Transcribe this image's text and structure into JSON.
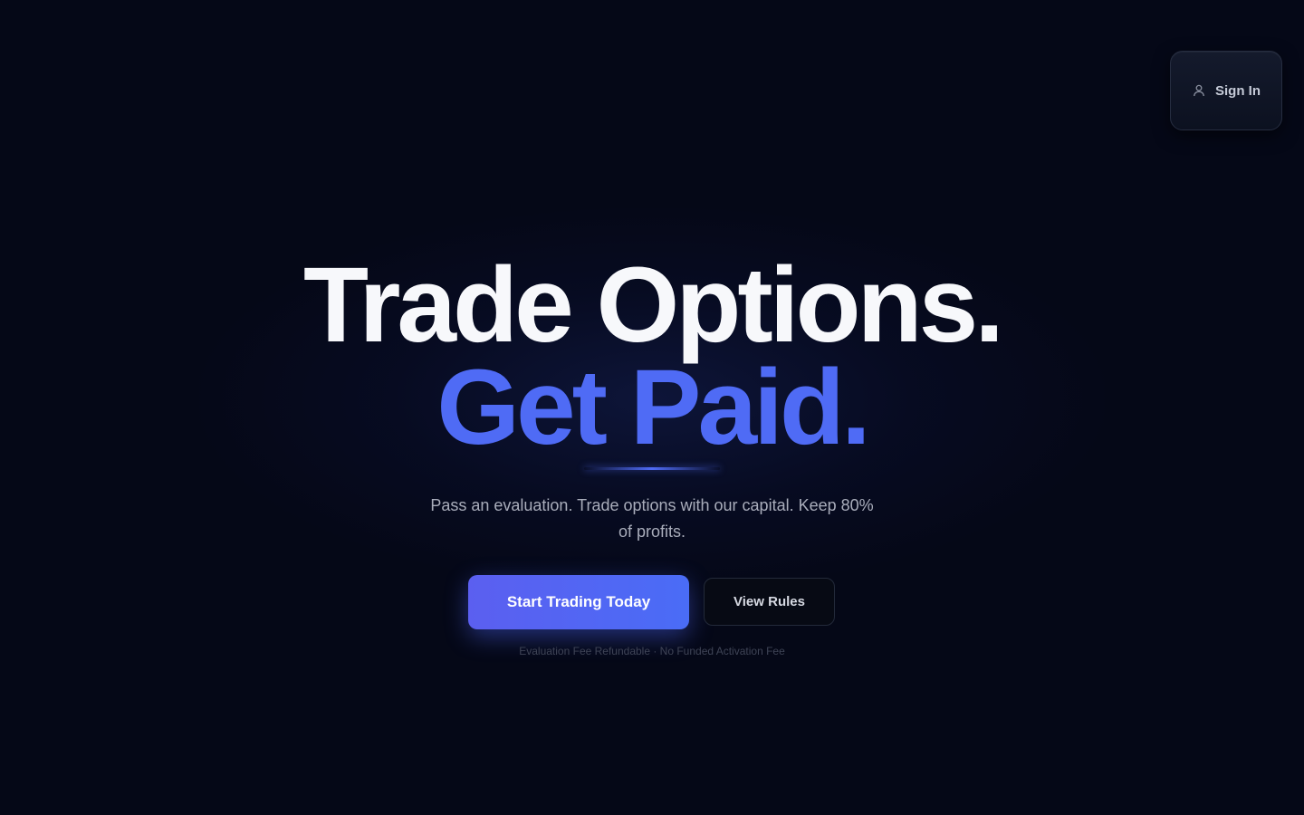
{
  "header": {
    "signin_label": "Sign In",
    "signin_icon": "user-icon"
  },
  "hero": {
    "headline_line1": "Trade Options.",
    "headline_line2": "Get Paid.",
    "subtitle": "Pass an evaluation. Trade options with our capital. Keep 80% of profits.",
    "primary_cta": "Start Trading Today",
    "secondary_cta": "View Rules",
    "fineprint": "Evaluation Fee Refundable · No Funded Activation Fee"
  },
  "colors": {
    "background": "#050817",
    "accent": "#4f6bf5",
    "headline": "#f7f8fb",
    "subtitle": "#a9adbb"
  }
}
